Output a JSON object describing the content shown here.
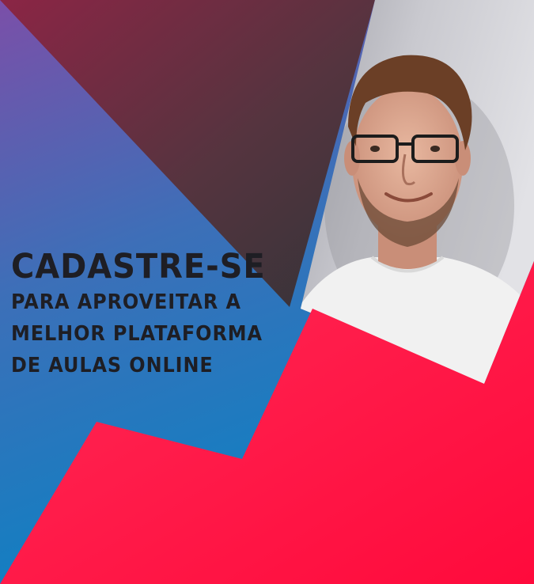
{
  "banner": {
    "headline": "CADASTRE-SE",
    "subline_1": "PARA APROVEITAR A",
    "subline_2": "MELHOR PLATAFORMA",
    "subline_3": "DE AULAS ONLINE"
  },
  "colors": {
    "purple": "#7b4fa8",
    "blue": "#0c7fc0",
    "wine": "#8b2545",
    "charcoal": "#3a3a40",
    "red": "#ff1a4a",
    "text": "#1e1e24"
  },
  "photo": {
    "icon": "person-photo"
  }
}
